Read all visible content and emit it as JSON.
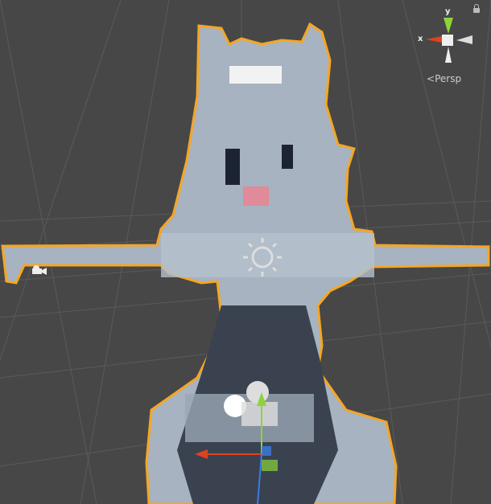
{
  "view": {
    "projection_label": "Persp",
    "axis_x": "x",
    "axis_y": "y"
  },
  "colors": {
    "background": "#474747",
    "selection_outline": "#f5a623",
    "x_axis": "#e0421f",
    "y_axis": "#8cd43a",
    "z_axis": "#3a7de0"
  }
}
